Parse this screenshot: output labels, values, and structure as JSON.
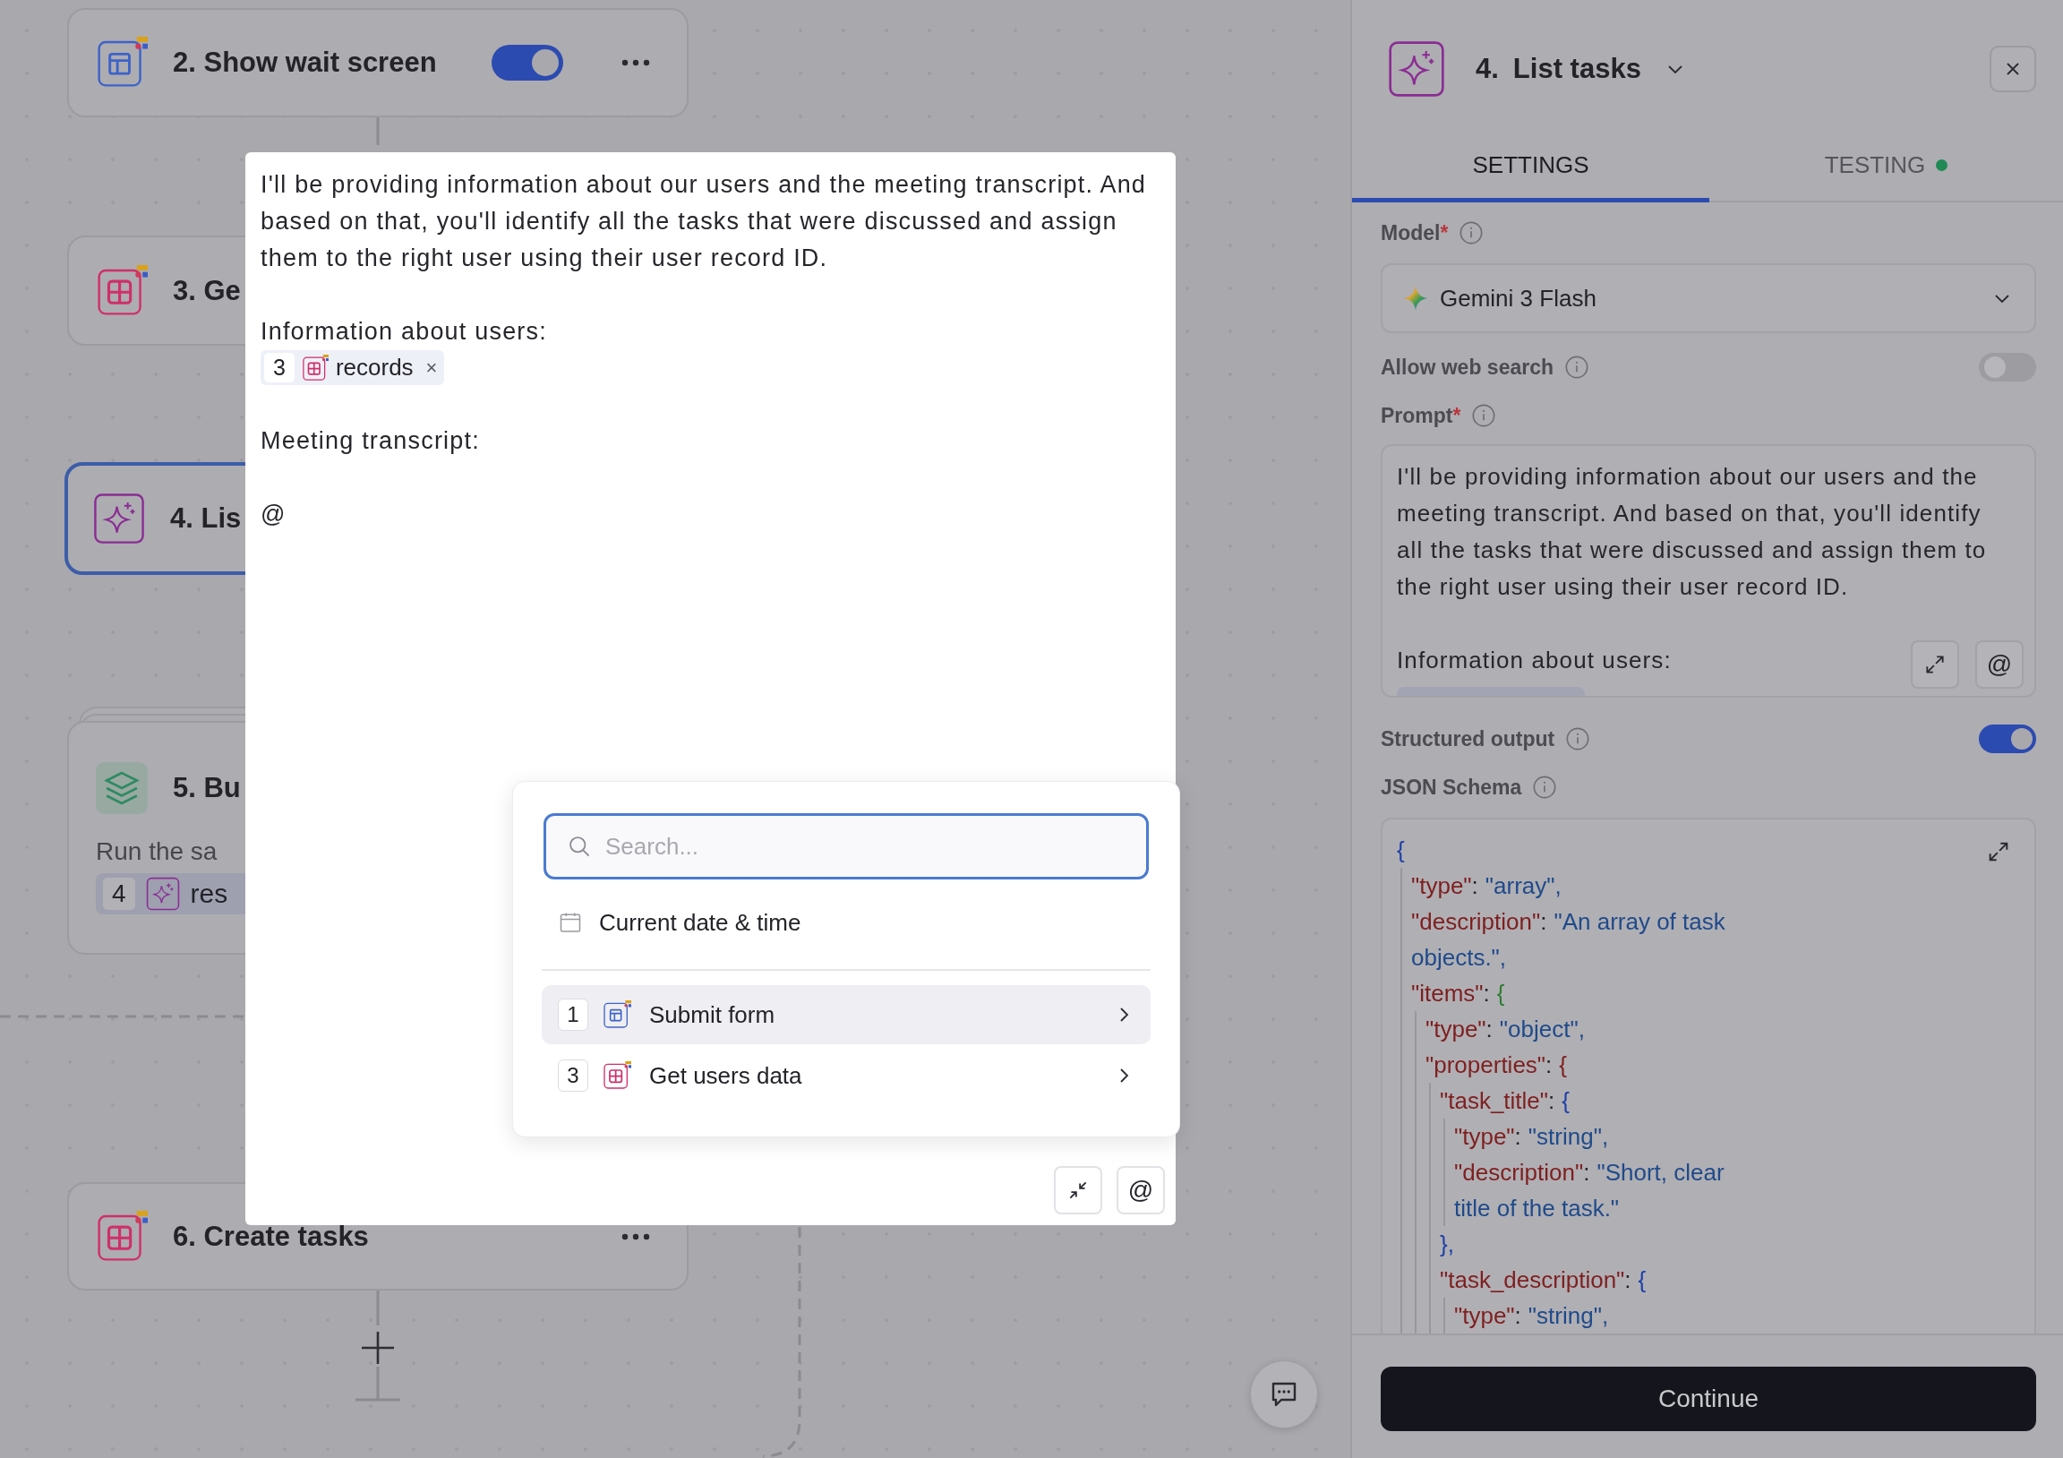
{
  "canvas": {
    "nodes": [
      {
        "kind": "form",
        "title": "2. Show wait screen",
        "selected": false,
        "toggle_on": true,
        "menu": true
      },
      {
        "kind": "table",
        "title": "3. Ge",
        "selected": false
      },
      {
        "kind": "ai",
        "title": "4. Lis",
        "selected": true
      },
      {
        "kind": "loop",
        "title": "5. Bu",
        "selected": false,
        "description": "Run the sa",
        "chip": {
          "number": "4",
          "kind": "ai",
          "label": "res"
        }
      },
      {
        "kind": "table",
        "title": "6. Create tasks",
        "selected": false,
        "menu": true
      }
    ]
  },
  "editor": {
    "blocks": [
      {
        "kind": "text",
        "text": "I'll be providing information about our users and the meeting transcript. And based on that, you'll identify all the tasks that were discussed and assign them to the right user using their user record ID."
      },
      {
        "kind": "text",
        "text": "Information about users:"
      },
      {
        "kind": "chip",
        "step": {
          "number": "3",
          "kind": "table"
        },
        "label": "records",
        "remove": "×"
      },
      {
        "kind": "text",
        "text": "Meeting transcript:"
      },
      {
        "kind": "text",
        "text": "@"
      }
    ],
    "mention_button": "@"
  },
  "picker": {
    "search": {
      "placeholder": "Search..."
    },
    "current_date": "Current date & time",
    "steps": [
      {
        "number": "1",
        "kind": "form",
        "label": "Submit form",
        "selected": true
      },
      {
        "number": "3",
        "kind": "table",
        "label": "Get users data",
        "selected": false
      }
    ]
  },
  "panel": {
    "step_number": "4.",
    "title": "List tasks",
    "tabs": [
      {
        "label": "SETTINGS",
        "selected": true
      },
      {
        "label": "TESTING",
        "selected": false,
        "color": "#1f8a55"
      }
    ],
    "model": {
      "label": "Model",
      "required_mark": "*",
      "value": "Gemini 3 Flash"
    },
    "web_search": {
      "label": "Allow web search",
      "on": false
    },
    "prompt": {
      "label": "Prompt",
      "required_mark": "*",
      "paragraphs": [
        "I'll be providing information about our users and the meeting transcript. And based on that, you'll identify all the tasks that were discussed and assign them to the right user using their user record ID.",
        "Information about users:"
      ],
      "mention_button": "@"
    },
    "structured_output": {
      "label": "Structured output",
      "on": true
    },
    "schema": {
      "label": "JSON Schema",
      "code": {
        "open": "{",
        "children": [
          {
            "key": "\"type\"",
            "sep": ":",
            "value": "\"array\","
          },
          {
            "key": "\"description\"",
            "sep": ":",
            "value": "\"An array of task objects.\","
          },
          {
            "key": "\"items\"",
            "sep": ":",
            "open": "{",
            "children": [
              {
                "key": "\"type\"",
                "sep": ":",
                "value": "\"object\","
              },
              {
                "key": "\"properties\"",
                "sep": ":",
                "open": "{",
                "children": [
                  {
                    "key": "\"task_title\"",
                    "sep": ":",
                    "open": "{",
                    "children": [
                      {
                        "key": "\"type\"",
                        "sep": ":",
                        "value": "\"string\","
                      },
                      {
                        "key": "\"description\"",
                        "sep": ":",
                        "value": "\"Short, clear title of the task.\""
                      }
                    ],
                    "close": "},"
                  },
                  {
                    "key": "\"task_description\"",
                    "sep": ":",
                    "open": "{",
                    "children": [
                      {
                        "key": "\"type\"",
                        "sep": ":",
                        "value": "\"string\","
                      }
                    ]
                  }
                ]
              }
            ]
          }
        ]
      }
    },
    "continue_button": "Continue"
  }
}
